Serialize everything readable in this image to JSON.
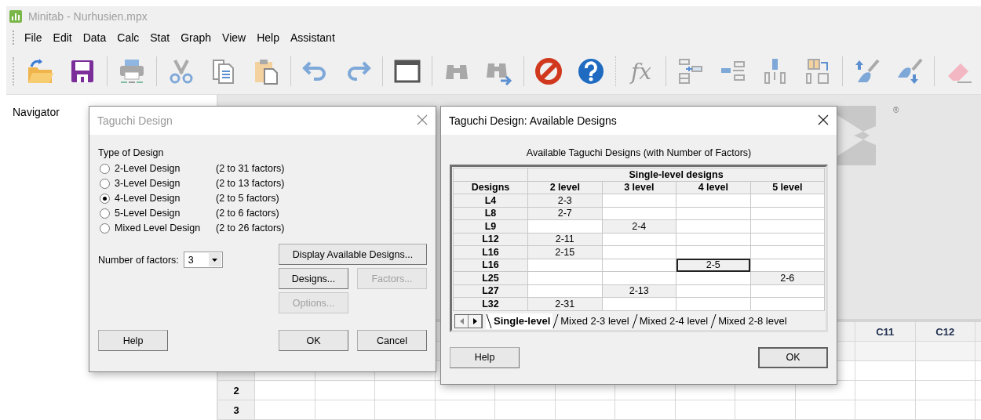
{
  "window": {
    "title": "Minitab - Nurhusien.mpx"
  },
  "menu": [
    "File",
    "Edit",
    "Data",
    "Calc",
    "Stat",
    "Graph",
    "View",
    "Help",
    "Assistant"
  ],
  "toolbar": {
    "formula_label": "fx"
  },
  "navigator": {
    "title": "Navigator"
  },
  "workspace": {
    "logo_mark": "®"
  },
  "worksheet": {
    "columns": [
      "C11",
      "C12"
    ],
    "rows": [
      "2",
      "3"
    ]
  },
  "taguchi_dialog": {
    "title": "Taguchi Design",
    "active": false,
    "group_label": "Type of Design",
    "design_types": [
      {
        "label": "2-Level Design",
        "range": "(2 to 31 factors)",
        "selected": false
      },
      {
        "label": "3-Level Design",
        "range": "(2 to 13 factors)",
        "selected": false
      },
      {
        "label": "4-Level Design",
        "range": "(2 to 5 factors)",
        "selected": true
      },
      {
        "label": "5-Level Design",
        "range": "(2 to 6 factors)",
        "selected": false
      },
      {
        "label": "Mixed Level Design",
        "range": "(2 to 26 factors)",
        "selected": false
      }
    ],
    "factors_label": "Number of factors:",
    "factors_value": "3",
    "buttons": [
      {
        "label": "Display Available Designs...",
        "kind": "side",
        "disabled": false
      },
      {
        "label": "Designs...",
        "kind": "side",
        "disabled": false
      },
      {
        "label": "Factors...",
        "kind": "side",
        "disabled": true
      },
      {
        "label": "Options...",
        "kind": "side",
        "disabled": true
      },
      {
        "label": "Help",
        "kind": "footer",
        "disabled": false
      },
      {
        "label": "OK",
        "kind": "footer",
        "disabled": false
      },
      {
        "label": "Cancel",
        "kind": "footer",
        "disabled": false
      }
    ]
  },
  "designs_dialog": {
    "title": "Taguchi Design: Available Designs",
    "active": true,
    "caption": "Available Taguchi Designs (with Number of Factors)",
    "group_header": "Single-level designs",
    "designs_header": "Designs",
    "columns": [
      "2 level",
      "3 level",
      "4 level",
      "5 level"
    ],
    "rows": [
      {
        "design": "L4",
        "cells": [
          {
            "text": "2-3",
            "selected": false
          },
          null,
          null,
          null
        ]
      },
      {
        "design": "L8",
        "cells": [
          {
            "text": "2-7",
            "selected": false
          },
          null,
          null,
          null
        ]
      },
      {
        "design": "L9",
        "cells": [
          null,
          {
            "text": "2-4",
            "selected": false
          },
          null,
          null
        ]
      },
      {
        "design": "L12",
        "cells": [
          {
            "text": "2-11",
            "selected": false
          },
          null,
          null,
          null
        ]
      },
      {
        "design": "L16",
        "cells": [
          {
            "text": "2-15",
            "selected": false
          },
          null,
          null,
          null
        ]
      },
      {
        "design": "L16",
        "cells": [
          null,
          null,
          {
            "text": "2-5",
            "selected": true
          },
          null
        ]
      },
      {
        "design": "L25",
        "cells": [
          null,
          null,
          null,
          {
            "text": "2-6",
            "selected": false
          }
        ]
      },
      {
        "design": "L27",
        "cells": [
          null,
          {
            "text": "2-13",
            "selected": false
          },
          null,
          null
        ]
      },
      {
        "design": "L32",
        "cells": [
          {
            "text": "2-31",
            "selected": false
          },
          null,
          null,
          null
        ]
      }
    ],
    "tabs": [
      {
        "label": "Single-level",
        "selected": true
      },
      {
        "label": "Mixed 2-3 level",
        "selected": false
      },
      {
        "label": "Mixed 2-4 level",
        "selected": false
      },
      {
        "label": "Mixed 2-8 level",
        "selected": false
      }
    ],
    "buttons": [
      {
        "label": "Help",
        "default": false
      },
      {
        "label": "OK",
        "default": true
      }
    ]
  }
}
